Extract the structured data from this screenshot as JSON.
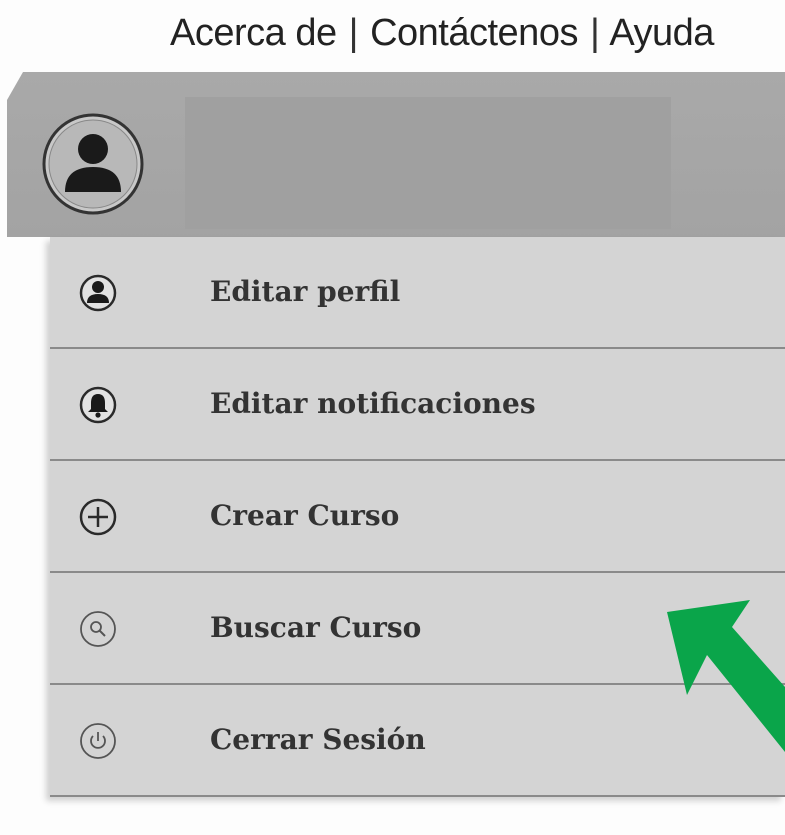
{
  "header": {
    "links": [
      "Acerca de",
      "Contáctenos",
      "Ayuda"
    ],
    "separator": "|"
  },
  "profile": {
    "avatar_icon": "user-avatar-icon"
  },
  "menu": {
    "items": [
      {
        "label": "Editar perfil",
        "icon": "user-icon"
      },
      {
        "label": "Editar notificaciones",
        "icon": "bell-icon"
      },
      {
        "label": "Crear Curso",
        "icon": "plus-icon"
      },
      {
        "label": "Buscar Curso",
        "icon": "search-icon"
      },
      {
        "label": "Cerrar Sesión",
        "icon": "power-icon"
      }
    ]
  },
  "annotation": {
    "arrow_color": "#0aa54a",
    "points_to": "Buscar Curso"
  },
  "colors": {
    "profile_bar": "#a6a6a6",
    "menu_bg": "#d4d4d4",
    "divider": "#8a8a8a"
  }
}
